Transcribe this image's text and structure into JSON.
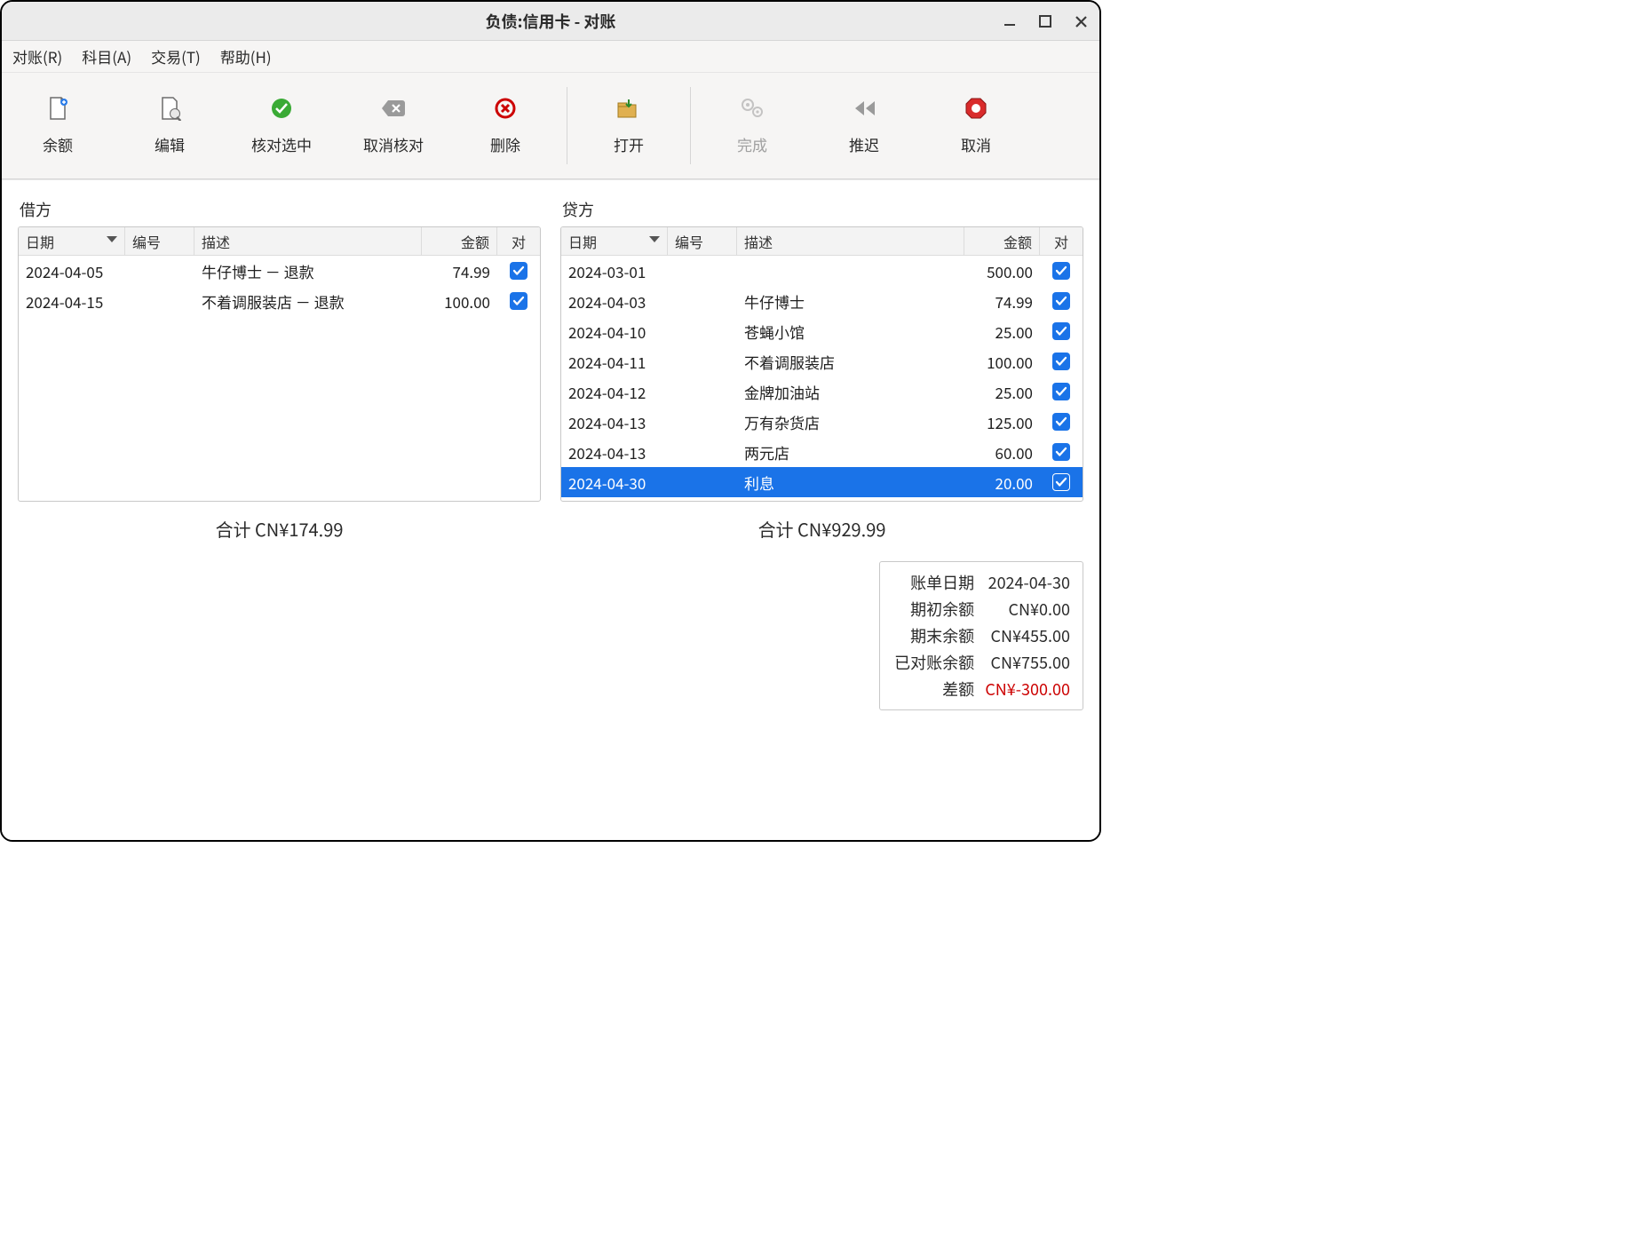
{
  "window": {
    "title": "负债:信用卡 - 对账"
  },
  "menu": {
    "reconcile": "对账(R)",
    "account": "科目(A)",
    "transaction": "交易(T)",
    "help": "帮助(H)"
  },
  "toolbar": {
    "balance": "余额",
    "edit": "编辑",
    "reconcile_sel": "核对选中",
    "unreconcile": "取消核对",
    "delete": "删除",
    "open": "打开",
    "finish": "完成",
    "postpone": "推迟",
    "cancel": "取消"
  },
  "columns": {
    "date": "日期",
    "num": "编号",
    "desc": "描述",
    "amount": "金额",
    "recn": "对"
  },
  "debit": {
    "title": "借方",
    "rows": [
      {
        "date": "2024-04-05",
        "num": "",
        "desc": "牛仔博士 － 退款",
        "amount": "74.99",
        "checked": true,
        "selected": false
      },
      {
        "date": "2024-04-15",
        "num": "",
        "desc": "不着调服装店 － 退款",
        "amount": "100.00",
        "checked": true,
        "selected": false
      }
    ],
    "total": "合计 CN¥174.99"
  },
  "credit": {
    "title": "贷方",
    "rows": [
      {
        "date": "2024-03-01",
        "num": "",
        "desc": "",
        "amount": "500.00",
        "checked": true,
        "selected": false
      },
      {
        "date": "2024-04-03",
        "num": "",
        "desc": "牛仔博士",
        "amount": "74.99",
        "checked": true,
        "selected": false
      },
      {
        "date": "2024-04-10",
        "num": "",
        "desc": "苍蝇小馆",
        "amount": "25.00",
        "checked": true,
        "selected": false
      },
      {
        "date": "2024-04-11",
        "num": "",
        "desc": "不着调服装店",
        "amount": "100.00",
        "checked": true,
        "selected": false
      },
      {
        "date": "2024-04-12",
        "num": "",
        "desc": "金牌加油站",
        "amount": "25.00",
        "checked": true,
        "selected": false
      },
      {
        "date": "2024-04-13",
        "num": "",
        "desc": "万有杂货店",
        "amount": "125.00",
        "checked": true,
        "selected": false
      },
      {
        "date": "2024-04-13",
        "num": "",
        "desc": "两元店",
        "amount": "60.00",
        "checked": true,
        "selected": false
      },
      {
        "date": "2024-04-30",
        "num": "",
        "desc": "利息",
        "amount": "20.00",
        "checked": true,
        "selected": true
      }
    ],
    "total": "合计 CN¥929.99"
  },
  "summary": {
    "statement_date_label": "账单日期",
    "statement_date": "2024-04-30",
    "starting_label": "期初余额",
    "starting": "CN¥0.00",
    "ending_label": "期末余额",
    "ending": "CN¥455.00",
    "reconciled_label": "已对账余额",
    "reconciled": "CN¥755.00",
    "diff_label": "差额",
    "diff": "CN¥-300.00"
  }
}
